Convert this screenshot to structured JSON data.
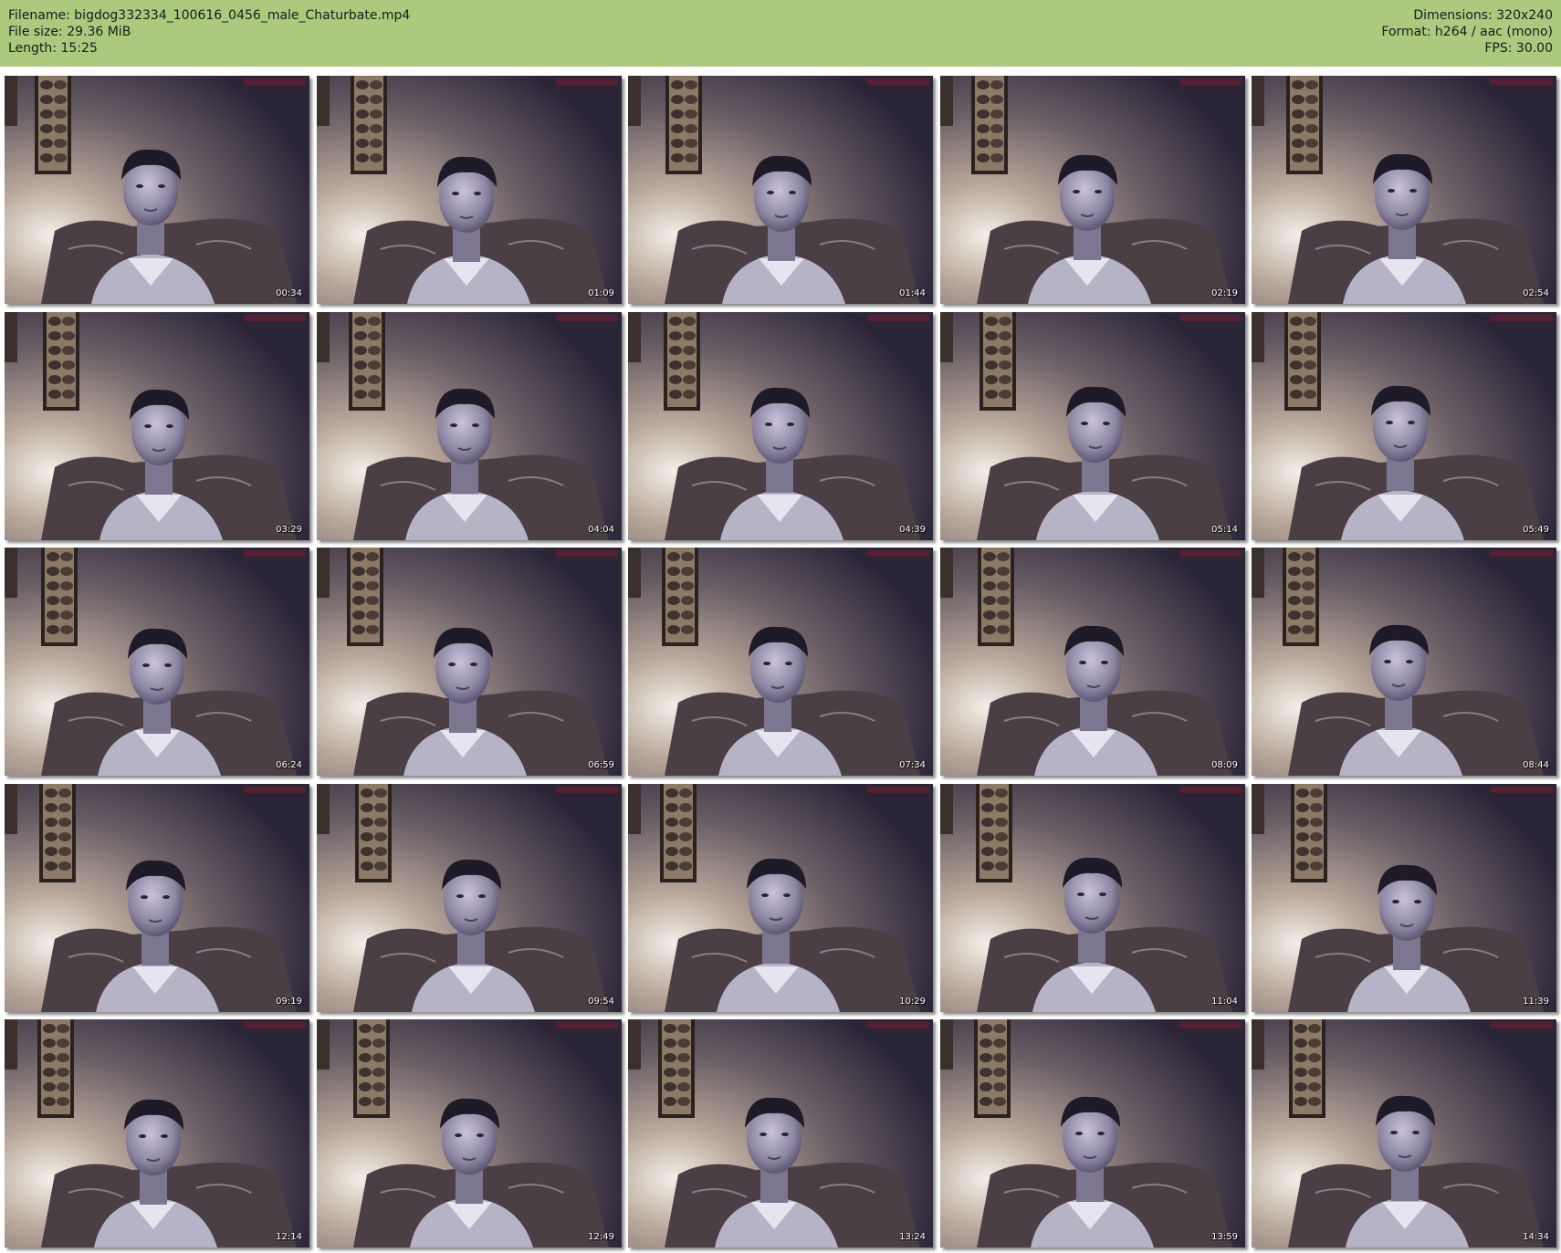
{
  "header": {
    "filename": "Filename: bigdog332334_100616_0456_male_Chaturbate.mp4",
    "filesize": "File size: 29.36 MiB",
    "length": "Length: 15:25",
    "dimensions": "Dimensions: 320x240",
    "format": "Format: h264 / aac (mono)",
    "fps": "FPS: 30.00"
  },
  "colors": {
    "header_bg": "#adc97e",
    "page_bg": "#ffffff"
  },
  "thumbnails": [
    {
      "time": "00:34"
    },
    {
      "time": "01:09"
    },
    {
      "time": "01:44"
    },
    {
      "time": "02:19"
    },
    {
      "time": "02:54"
    },
    {
      "time": "03:29"
    },
    {
      "time": "04:04"
    },
    {
      "time": "04:39"
    },
    {
      "time": "05:14"
    },
    {
      "time": "05:49"
    },
    {
      "time": "06:24"
    },
    {
      "time": "06:59"
    },
    {
      "time": "07:34"
    },
    {
      "time": "08:09"
    },
    {
      "time": "08:44"
    },
    {
      "time": "09:19"
    },
    {
      "time": "09:54"
    },
    {
      "time": "10:29"
    },
    {
      "time": "11:04"
    },
    {
      "time": "11:39"
    },
    {
      "time": "12:14"
    },
    {
      "time": "12:49"
    },
    {
      "time": "13:24"
    },
    {
      "time": "13:59"
    },
    {
      "time": "14:34"
    }
  ]
}
